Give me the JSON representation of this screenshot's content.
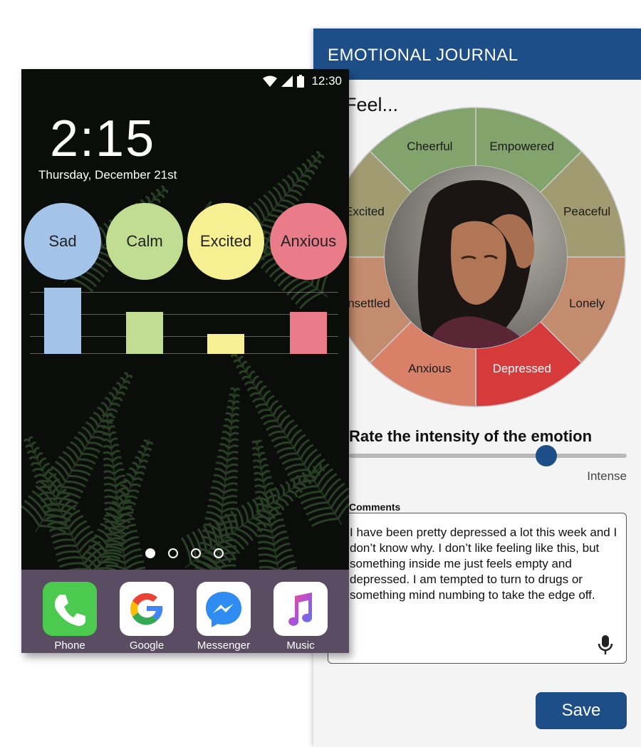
{
  "journal": {
    "title": "EMOTIONAL JOURNAL",
    "feel_heading": "Feel...",
    "wheel": {
      "outer_segments": [
        {
          "label": "Cheerful",
          "color": "#82a36c"
        },
        {
          "label": "Empowered",
          "color": "#82a36c"
        },
        {
          "label": "Peaceful",
          "color": "#a19b72"
        },
        {
          "label": "Lonely",
          "color": "#c48c6e"
        },
        {
          "label": "Depressed",
          "color": "#d63a3a"
        },
        {
          "label": "Anxious",
          "color": "#d98068"
        },
        {
          "label": "Unsettled",
          "color": "#c48c6e"
        },
        {
          "label": "Excited",
          "color": "#a19b72"
        }
      ]
    },
    "intensity_label": "Rate the intensity of the emotion",
    "intensity_level": 0.71,
    "intense_label": "Intense",
    "comments_label": "Comments",
    "comments_text": "I have been pretty depressed a lot this week and I don’t know why. I don’t like feeling like this, but something inside me just feels empty and depressed. I am tempted to turn to drugs or something mind numbing to take the edge off.",
    "save_label": "Save"
  },
  "phone": {
    "status_time": "12:30",
    "clock": "2:15",
    "date": "Thursday, December 21st",
    "moods": [
      {
        "label": "Sad",
        "color": "#a3c4e8",
        "level": 0.98
      },
      {
        "label": "Calm",
        "color": "#c0dd92",
        "level": 0.62
      },
      {
        "label": "Excited",
        "color": "#f6f092",
        "level": 0.29
      },
      {
        "label": "Anxious",
        "color": "#ea7b89",
        "level": 0.62
      }
    ],
    "page_dots": 4,
    "active_page": 1,
    "dock_apps": [
      {
        "label": "Phone",
        "icon": "phone-icon"
      },
      {
        "label": "Google",
        "icon": "google-icon"
      },
      {
        "label": "Messenger",
        "icon": "messenger-icon"
      },
      {
        "label": "Music",
        "icon": "music-icon"
      }
    ]
  }
}
